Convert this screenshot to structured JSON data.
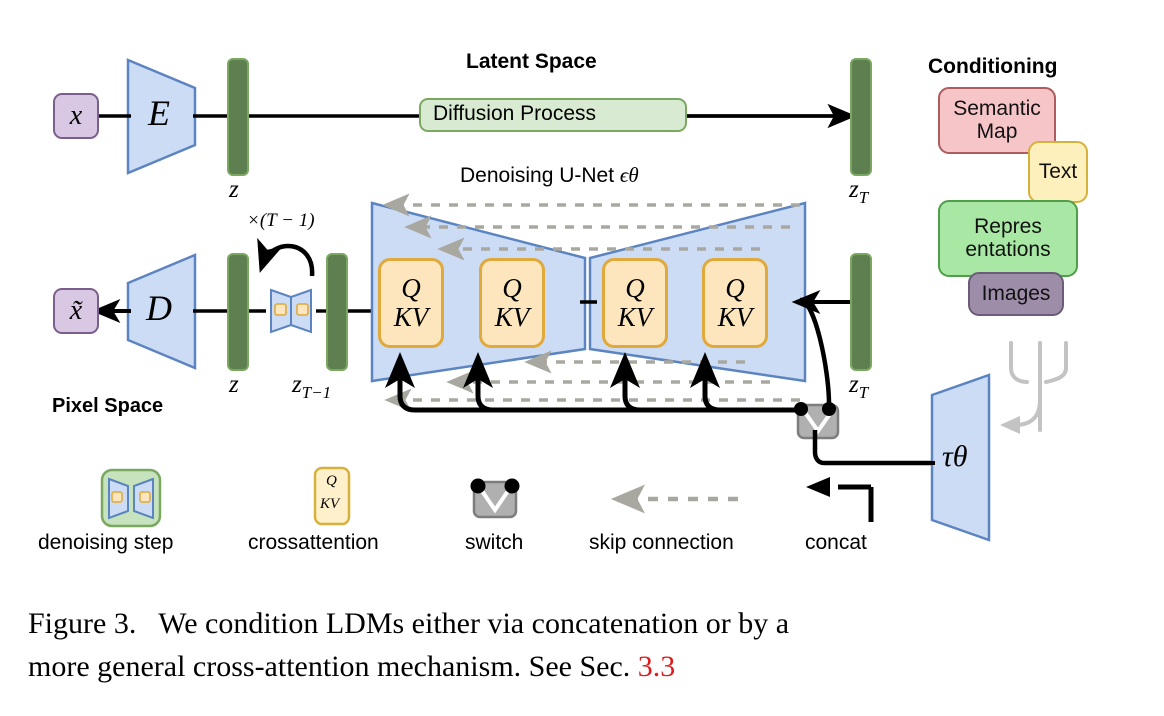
{
  "figure": {
    "number": "Figure 3.",
    "caption_line1": "We condition LDMs either via concatenation or by a",
    "caption_line2": "more general cross-attention mechanism. See Sec.",
    "section_ref": "3.3",
    "section_ref_color": "#e01b1b"
  },
  "pixel_space": {
    "title": "Pixel Space",
    "input_label": "x",
    "output_label": "x̃",
    "encoder_label": "E",
    "decoder_label": "D",
    "fill": "#f9c9c9",
    "border": "#b45555"
  },
  "latent_space": {
    "title": "Latent Space",
    "diffusion_label": "Diffusion Process",
    "unet_title": "Denoising U-Net",
    "unet_symbol": "ϵθ",
    "fill": "#d8ebd2",
    "border": "#7aa860",
    "z_labels": {
      "z_left_top": "z",
      "z_left_bottom": "z",
      "z_T_top": "z_T",
      "z_T_bottom": "z_T",
      "z_T_minus_1": "z_{T-1}"
    },
    "loop_label": "×(T − 1)",
    "attention_blocks": [
      {
        "q": "Q",
        "kv": "KV"
      },
      {
        "q": "Q",
        "kv": "KV"
      },
      {
        "q": "Q",
        "kv": "KV"
      },
      {
        "q": "Q",
        "kv": "KV"
      }
    ]
  },
  "conditioning": {
    "title": "Conditioning",
    "encoder_label": "τθ",
    "items": [
      {
        "label_line1": "Semantic",
        "label_line2": "Map",
        "fill": "#f6c5c7",
        "border": "#ad5c60"
      },
      {
        "label_line1": "Text",
        "label_line2": "",
        "fill": "#fdf0bc",
        "border": "#d6b23c"
      },
      {
        "label_line1": "Repres",
        "label_line2": "entations",
        "fill": "#a8e8a4",
        "border": "#4e9e4a"
      },
      {
        "label_line1": "Images",
        "label_line2": "",
        "fill": "#9d8da8",
        "border": "#6b5c78"
      }
    ]
  },
  "legend": {
    "items": [
      {
        "label": "denoising step",
        "icon": "denoising-step-icon"
      },
      {
        "label": "crossattention",
        "icon": "crossattention-icon",
        "q": "Q",
        "kv": "KV"
      },
      {
        "label": "switch",
        "icon": "switch-icon"
      },
      {
        "label": "skip connection",
        "icon": "skip-connection-icon"
      },
      {
        "label": "concat",
        "icon": "concat-icon"
      }
    ]
  },
  "colors": {
    "unet_blue_fill": "#ccdcf5",
    "unet_blue_border": "#5b84c0",
    "attention_fill": "#fde6bd",
    "attention_border": "#e0a93b",
    "z_bar_fill": "#5e8050",
    "skip_gray": "#a8a8a0",
    "switch_gray": "#b0b0b0"
  }
}
